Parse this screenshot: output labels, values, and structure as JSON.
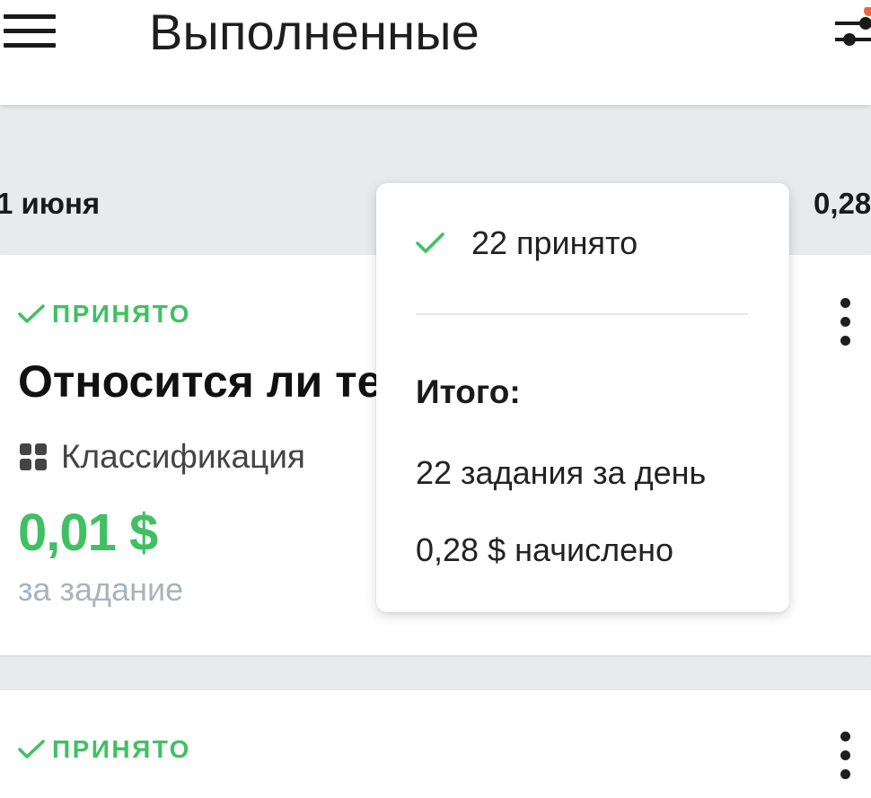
{
  "header": {
    "title": "Выполненные",
    "menu_icon": "hamburger-menu-icon",
    "filter_icon": "filter-sliders-icon",
    "filter_badge_color": "#f4623a"
  },
  "day": {
    "date": "1 июня",
    "sum": "0,28"
  },
  "cards": [
    {
      "status": "ПРИНЯТО",
      "title": "Относится ли те",
      "category": "Классификация",
      "price": "0,01 $",
      "price_unit": "за задание"
    },
    {
      "status": "ПРИНЯТО"
    }
  ],
  "popover": {
    "accepted": "22 принято",
    "total_title": "Итого:",
    "tasks_per_day": "22 задания за день",
    "earned": "0,28 $ начислено"
  },
  "colors": {
    "accent_green": "#40c063",
    "muted_text": "#aab3bb",
    "background": "#e8ebee"
  }
}
